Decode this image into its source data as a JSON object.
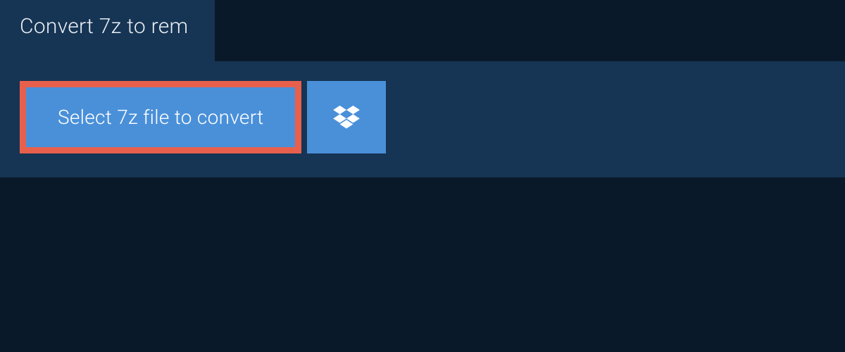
{
  "tab": {
    "title": "Convert 7z to rem"
  },
  "actions": {
    "select_label": "Select 7z file to convert"
  },
  "colors": {
    "bg_dark": "#0a1929",
    "bg_panel": "#163453",
    "button_blue": "#4a90d9",
    "highlight_red": "#e8604c"
  }
}
